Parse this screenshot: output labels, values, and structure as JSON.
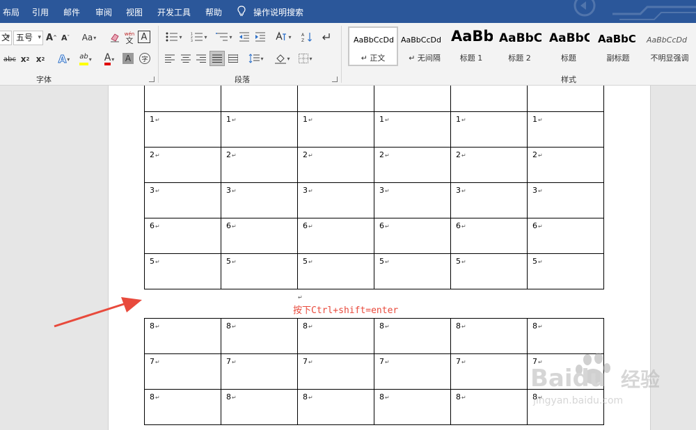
{
  "menu": {
    "tabs": [
      "布局",
      "引用",
      "邮件",
      "审阅",
      "视图",
      "开发工具",
      "帮助"
    ],
    "search_label": "操作说明搜索"
  },
  "ribbon": {
    "font": {
      "label": "字体",
      "font_name_partial": "文",
      "font_size": "五号",
      "grow_label": "A",
      "shrink_label": "A",
      "case_label": "Aa",
      "phonetic_top": "wén",
      "phonetic_bottom": "文",
      "border_char": "A",
      "strike_label": "abc",
      "sub_label": "x",
      "sup_label": "x",
      "effects_label": "A",
      "highlight_label": "ab",
      "color_label": "A",
      "shade_label": "A",
      "enclose_label": "字"
    },
    "paragraph": {
      "label": "段落"
    },
    "styles": {
      "label": "样式",
      "items": [
        {
          "preview": "AaBbCcDd",
          "name": "正文",
          "selected": true
        },
        {
          "preview": "AaBbCcDd",
          "name": "无间隔",
          "selected": false
        },
        {
          "preview": "AaBb",
          "name": "标题 1",
          "selected": false
        },
        {
          "preview": "AaBbC",
          "name": "标题 2",
          "selected": false
        },
        {
          "preview": "AaBbC",
          "name": "标题",
          "selected": false
        },
        {
          "preview": "AaBbC",
          "name": "副标题",
          "selected": false
        },
        {
          "preview": "AaBbCcDd",
          "name": "不明显强调",
          "selected": false
        }
      ]
    }
  },
  "document": {
    "table1_rows": [
      [
        "1",
        "1",
        "1",
        "1",
        "1",
        "1"
      ],
      [
        "2",
        "2",
        "2",
        "2",
        "2",
        "2"
      ],
      [
        "3",
        "3",
        "3",
        "3",
        "3",
        "3"
      ],
      [
        "6",
        "6",
        "6",
        "6",
        "6",
        "6"
      ],
      [
        "5",
        "5",
        "5",
        "5",
        "5",
        "5"
      ]
    ],
    "annotation": "按下Ctrl+shift=enter",
    "table2_rows": [
      [
        "8",
        "8",
        "8",
        "8",
        "8",
        "8"
      ],
      [
        "7",
        "7",
        "7",
        "7",
        "7",
        "7"
      ],
      [
        "8",
        "8",
        "8",
        "8",
        "8",
        "8"
      ]
    ]
  },
  "watermark": {
    "brand": "Baidu",
    "cn": "经验",
    "url": "jingyan.baidu.com"
  },
  "colors": {
    "titlebar": "#2b579a",
    "annotation": "#e84a3c",
    "arrow": "#e84a3c",
    "highlight_yellow": "#ffff00",
    "font_red": "#e00000"
  }
}
